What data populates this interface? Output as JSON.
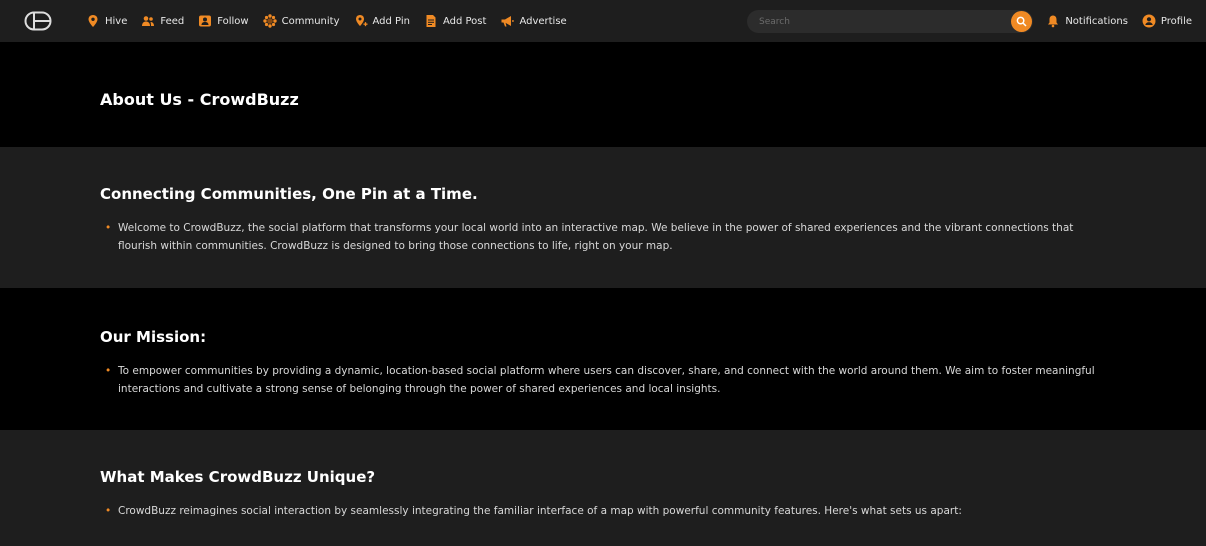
{
  "nav": {
    "items": [
      {
        "label": "Hive",
        "icon": "map-pin-icon"
      },
      {
        "label": "Feed",
        "icon": "users-icon"
      },
      {
        "label": "Follow",
        "icon": "user-card-icon"
      },
      {
        "label": "Community",
        "icon": "sunflower-icon"
      },
      {
        "label": "Add Pin",
        "icon": "add-pin-icon"
      },
      {
        "label": "Add Post",
        "icon": "document-icon"
      },
      {
        "label": "Advertise",
        "icon": "megaphone-icon"
      }
    ],
    "search_placeholder": "Search",
    "notifications_label": "Notifications",
    "profile_label": "Profile",
    "accent_color": "#f08a24"
  },
  "page": {
    "title": "About Us - CrowdBuzz",
    "sections": [
      {
        "heading": "Connecting Communities, One Pin at a Time.",
        "text": "Welcome to CrowdBuzz, the social platform that transforms your local world into an interactive map. We believe in the power of shared experiences and the vibrant connections that flourish within communities. CrowdBuzz is designed to bring those connections to life, right on your map."
      },
      {
        "heading": "Our Mission:",
        "text": "To empower communities by providing a dynamic, location-based social platform where users can discover, share, and connect with the world around them. We aim to foster meaningful interactions and cultivate a strong sense of belonging through the power of shared experiences and local insights."
      },
      {
        "heading": "What Makes CrowdBuzz Unique?",
        "text": "CrowdBuzz reimagines social interaction by seamlessly integrating the familiar interface of a map with powerful community features. Here's what sets us apart:"
      }
    ]
  }
}
